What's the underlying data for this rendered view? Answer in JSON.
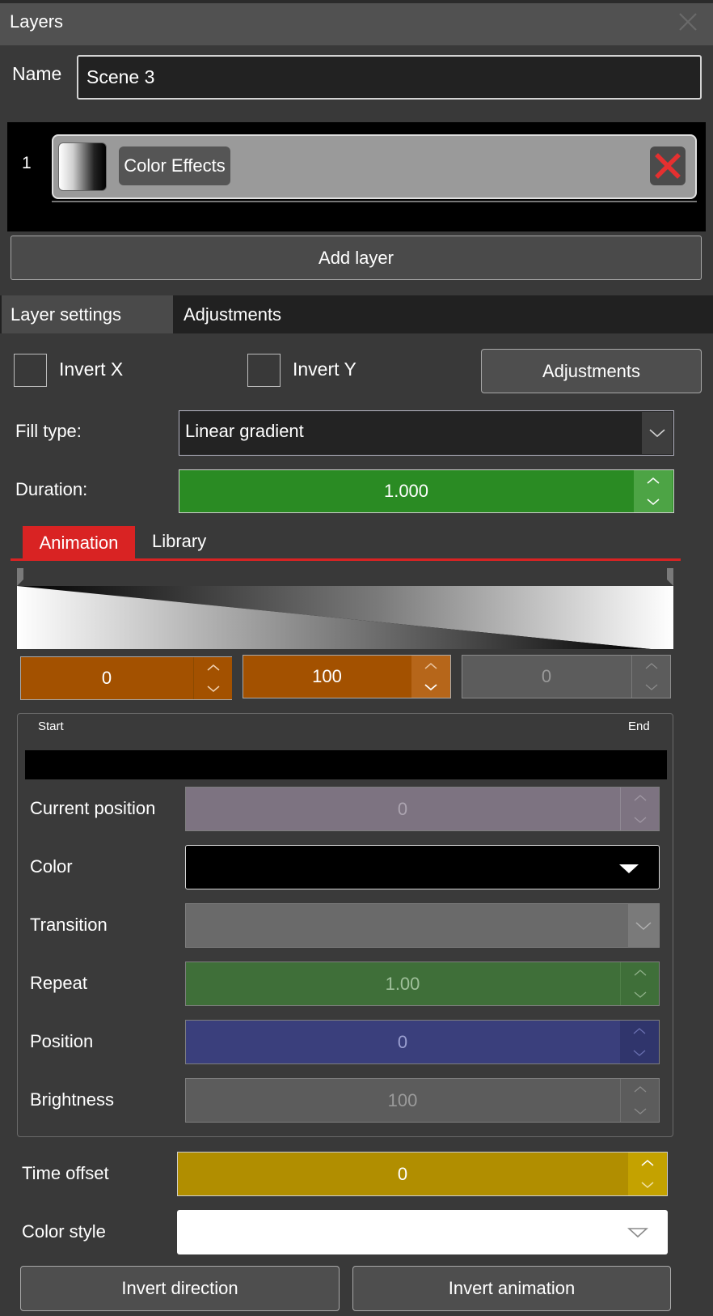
{
  "window": {
    "title": "Layers",
    "close_icon": "close-icon"
  },
  "scene": {
    "name_label": "Name",
    "name_value": "Scene 3"
  },
  "layers": [
    {
      "index": "1",
      "name": "Color Effects",
      "thumbnail_icon": "gradient-thumbnail",
      "delete_icon": "red-x-icon"
    }
  ],
  "add_layer_label": "Add layer",
  "tabs": {
    "layer_settings": "Layer settings",
    "adjustments": "Adjustments",
    "active": "layer_settings"
  },
  "options": {
    "invert_x": {
      "label": "Invert X",
      "checked": false
    },
    "invert_y": {
      "label": "Invert Y",
      "checked": false
    },
    "adjustments_button": "Adjustments"
  },
  "fill_type": {
    "label": "Fill type:",
    "value": "Linear gradient"
  },
  "duration": {
    "label": "Duration:",
    "value": "1.000"
  },
  "sub_tabs": {
    "animation": "Animation",
    "library": "Library",
    "active": "animation"
  },
  "gradient_stops": {
    "stop_a": "0",
    "stop_b": "100",
    "stop_c": "0"
  },
  "stop_editor": {
    "start_label": "Start",
    "end_label": "End",
    "current_position": {
      "label": "Current position",
      "value": "0"
    },
    "color": {
      "label": "Color",
      "value_color": "#000000"
    },
    "transition": {
      "label": "Transition",
      "value": ""
    },
    "repeat": {
      "label": "Repeat",
      "value": "1.00"
    },
    "position": {
      "label": "Position",
      "value": "0"
    },
    "brightness": {
      "label": "Brightness",
      "value": "100"
    }
  },
  "time_offset": {
    "label": "Time offset",
    "value": "0"
  },
  "color_style": {
    "label": "Color style",
    "value": ""
  },
  "buttons": {
    "invert_direction": "Invert direction",
    "invert_animation": "Invert animation"
  },
  "colors": {
    "accent_red": "#d92323",
    "duration_green": "#2a8b23",
    "stop_orange": "#a35100",
    "time_offset_yellow": "#b18e00",
    "position_blue": "#3a3f7c"
  }
}
